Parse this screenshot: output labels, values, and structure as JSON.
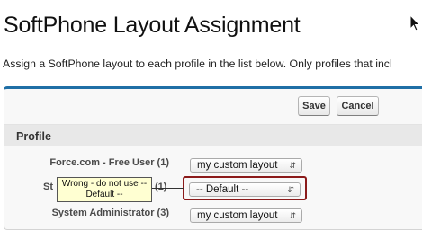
{
  "page": {
    "title": "SoftPhone Layout Assignment",
    "instructions": "Assign a SoftPhone layout to each profile in the list below. Only profiles that incl"
  },
  "toolbar": {
    "save_label": "Save",
    "cancel_label": "Cancel"
  },
  "section": {
    "title": "Profile"
  },
  "rows": [
    {
      "profile": "Force.com - Free User (1)",
      "layout": "my custom layout"
    },
    {
      "profile": "Standard User (1)",
      "visible_profile_start": "St",
      "visible_profile_end": "(1)",
      "layout": "-- Default --"
    },
    {
      "profile": "System Administrator (3)",
      "layout": "my custom layout"
    }
  ],
  "callout": {
    "line1": "Wrong - do not use --",
    "line2": "Default --"
  },
  "icons": {
    "cursor": "mouse-pointer-icon",
    "select_arrow": "select-updown-arrow-icon"
  },
  "colors": {
    "panel_accent": "#1f6fa6",
    "highlight_border": "#8b1a1a",
    "callout_background": "#ffffd2"
  }
}
